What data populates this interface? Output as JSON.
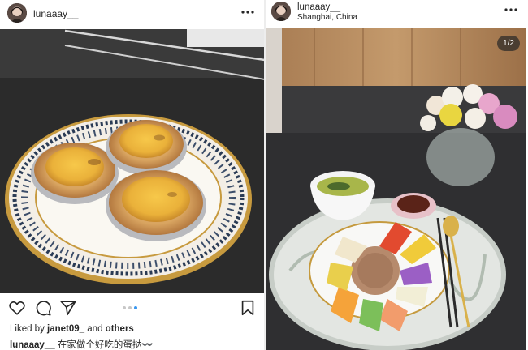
{
  "left_post": {
    "username": "lunaaay__",
    "likes": {
      "prefix": "Liked by",
      "user": "janet09_",
      "conj": "and",
      "others": "others"
    },
    "caption": {
      "username": "lunaaay__",
      "text": "在家做个好吃的蛋挞〰️"
    },
    "carousel": {
      "count": 3,
      "active_index": 2
    }
  },
  "right_post": {
    "username": "lunaaay__",
    "location": "Shanghai, China",
    "page_counter": "1/2"
  },
  "icons": {
    "more": "more-horizontal-icon",
    "like": "heart-icon",
    "comment": "comment-bubble-icon",
    "share": "paper-plane-icon",
    "save": "bookmark-icon"
  },
  "colors": {
    "text": "#262626",
    "carousel_active": "#3897f0",
    "carousel_inactive": "#c7c7c7"
  }
}
